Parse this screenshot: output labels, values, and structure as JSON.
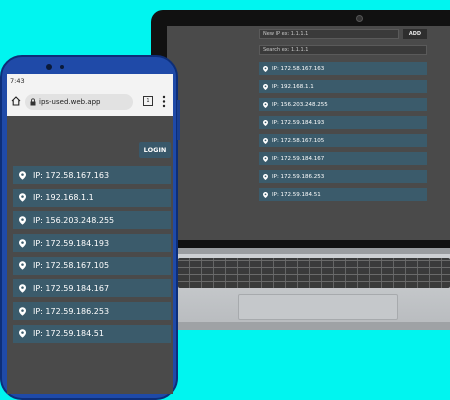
{
  "laptop": {
    "new_ip_placeholder": "New IP ex: 1.1.1.1",
    "add_button": "ADD",
    "search_placeholder": "Search ex: 1.1.1.1",
    "ips": [
      "IP: 172.58.167.163",
      "IP: 192.168.1.1",
      "IP: 156.203.248.255",
      "IP: 172.59.184.193",
      "IP: 172.58.167.105",
      "IP: 172.59.184.167",
      "IP: 172.59.186.253",
      "IP: 172.59.184.51"
    ]
  },
  "phone": {
    "time": "7:43",
    "url": "ips-used.web.app",
    "tabs_count": "1",
    "login_button": "LOGIN",
    "ips": [
      "IP: 172.58.167.163",
      "IP: 192.168.1.1",
      "IP: 156.203.248.255",
      "IP: 172.59.184.193",
      "IP: 172.58.167.105",
      "IP: 172.59.184.167",
      "IP: 172.59.186.253",
      "IP: 172.59.184.51"
    ]
  },
  "colors": {
    "background": "#00f5f0",
    "item": "#3b5b6b",
    "screen": "#4a4a4a",
    "phone_body": "#1f4aa8"
  },
  "icons": [
    "location-pin-icon",
    "home-icon",
    "lock-icon",
    "tabs-icon",
    "menu-dots-icon"
  ]
}
